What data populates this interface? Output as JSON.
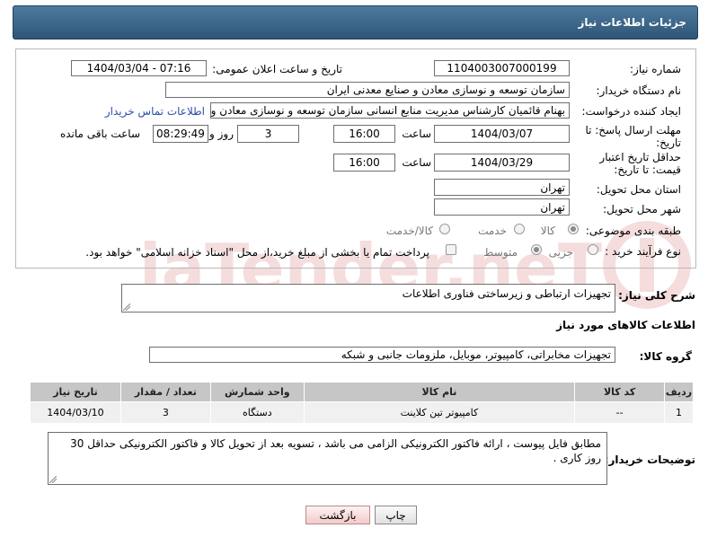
{
  "header": {
    "title": "جزئیات اطلاعات نیاز"
  },
  "form": {
    "need_number_label": "شماره نیاز:",
    "need_number": "1104003007000199",
    "announce_label": "تاریخ و ساعت اعلان عمومی:",
    "announce_value": "1404/03/04 - 07:16",
    "buyer_org_label": "نام دستگاه خریدار:",
    "buyer_org": "سازمان توسعه و نوسازی معادن و صنایع معدنی ایران",
    "creator_label": "ایجاد کننده درخواست:",
    "creator": "بهنام قائمیان کارشناس مدیریت منابع انسانی سازمان توسعه و نوسازی معادن و",
    "contact_link": "اطلاعات تماس خریدار",
    "deadline_label": "مهلت ارسال پاسخ: تا تاریخ:",
    "deadline_date": "1404/03/07",
    "hour_label": "ساعت",
    "deadline_time": "16:00",
    "days_value": "3",
    "days_label": "روز و",
    "remaining_time": "08:29:49",
    "remaining_label": "ساعت باقی مانده",
    "price_valid_label": "حداقل تاریخ اعتبار قیمت: تا تاریخ:",
    "price_valid_date": "1404/03/29",
    "price_valid_time": "16:00",
    "province_label": "استان محل تحویل:",
    "province": "تهران",
    "city_label": "شهر محل تحویل:",
    "city": "تهران",
    "category_label": "طبقه بندی موضوعی:",
    "category_options": [
      "کالا",
      "خدمت",
      "کالا/خدمت"
    ],
    "process_label": "نوع فرآیند خرید :",
    "process_options": [
      "جزیی",
      "متوسط"
    ],
    "payment_note": "پرداخت تمام یا بخشی از مبلغ خرید،از محل \"اسناد خزانه اسلامی\" خواهد بود."
  },
  "description": {
    "label": "شرح کلی نیاز:",
    "value": "تجهیزات ارتباطی و زیرساختی فناوری اطلاعات"
  },
  "goods": {
    "section_title": "اطلاعات کالاهای مورد نیاز",
    "group_label": "گروه کالا:",
    "group_value": "تجهیزات مخابراتی، کامپیوتر، موبایل، ملزومات جانبی و شبکه",
    "table": {
      "headers": [
        "ردیف",
        "کد کالا",
        "نام کالا",
        "واحد شمارش",
        "تعداد / مقدار",
        "تاریخ نیاز"
      ],
      "rows": [
        [
          "1",
          "--",
          "کامپیوتر تین کلاینت",
          "دستگاه",
          "3",
          "1404/03/10"
        ]
      ]
    }
  },
  "buyer_notes": {
    "label": "توضیحات خریدار:",
    "value": "مطابق فایل پیوست ، ارائه فاکتور الکترونیکی الزامی می باشد ، تسویه بعد از تحویل کالا و فاکتور الکترونیکی حداقل 30 روز کاری ."
  },
  "buttons": {
    "print": "چاپ",
    "back": "بازگشت"
  },
  "watermark": {
    "text": "AriaTender.neT"
  },
  "colors": {
    "header_bg": "#3e6a8d",
    "link": "#2a4fa6",
    "table_header": "#c6c6c6"
  }
}
